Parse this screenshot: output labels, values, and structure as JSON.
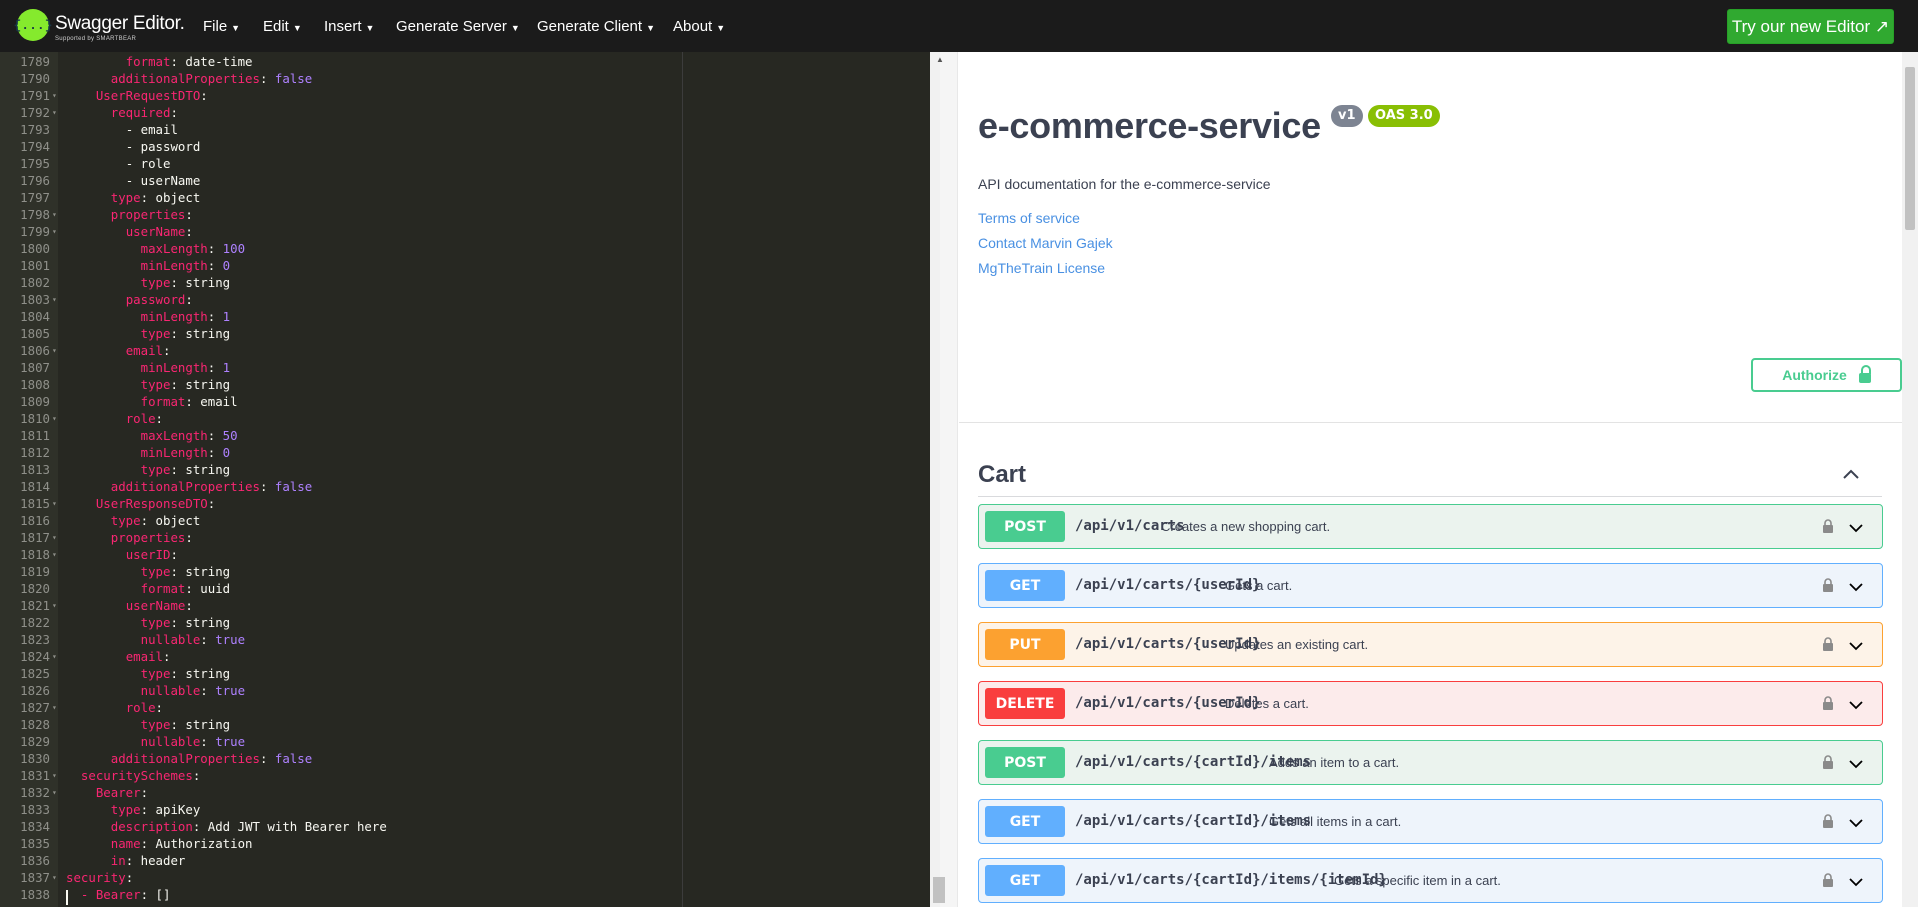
{
  "app": {
    "logo_glyph": "{...}",
    "name": "Swagger Editor.",
    "tagline": "Supported by SMARTBEAR",
    "menu": [
      "File",
      "Edit",
      "Insert",
      "Generate Server",
      "Generate Client",
      "About"
    ],
    "try_button": "Try our new Editor ↗"
  },
  "editor": {
    "lines": [
      {
        "num": "1789",
        "fold": "",
        "indent": "        ",
        "key": "format",
        "value": "date-time",
        "vtype": "v"
      },
      {
        "num": "1790",
        "fold": "",
        "indent": "      ",
        "key": "additionalProperties",
        "value": "false",
        "vtype": "b"
      },
      {
        "num": "1791",
        "fold": "▾",
        "indent": "    ",
        "key": "UserRequestDTO",
        "value": "",
        "vtype": "v"
      },
      {
        "num": "1792",
        "fold": "▾",
        "indent": "      ",
        "key": "required",
        "value": "",
        "vtype": "v"
      },
      {
        "num": "1793",
        "fold": "",
        "indent": "        ",
        "key": "",
        "value": "- email",
        "vtype": "v"
      },
      {
        "num": "1794",
        "fold": "",
        "indent": "        ",
        "key": "",
        "value": "- password",
        "vtype": "v"
      },
      {
        "num": "1795",
        "fold": "",
        "indent": "        ",
        "key": "",
        "value": "- role",
        "vtype": "v"
      },
      {
        "num": "1796",
        "fold": "",
        "indent": "        ",
        "key": "",
        "value": "- userName",
        "vtype": "v"
      },
      {
        "num": "1797",
        "fold": "",
        "indent": "      ",
        "key": "type",
        "value": "object",
        "vtype": "v"
      },
      {
        "num": "1798",
        "fold": "▾",
        "indent": "      ",
        "key": "properties",
        "value": "",
        "vtype": "v"
      },
      {
        "num": "1799",
        "fold": "▾",
        "indent": "        ",
        "key": "userName",
        "value": "",
        "vtype": "v"
      },
      {
        "num": "1800",
        "fold": "",
        "indent": "          ",
        "key": "maxLength",
        "value": "100",
        "vtype": "n"
      },
      {
        "num": "1801",
        "fold": "",
        "indent": "          ",
        "key": "minLength",
        "value": "0",
        "vtype": "n"
      },
      {
        "num": "1802",
        "fold": "",
        "indent": "          ",
        "key": "type",
        "value": "string",
        "vtype": "v"
      },
      {
        "num": "1803",
        "fold": "▾",
        "indent": "        ",
        "key": "password",
        "value": "",
        "vtype": "v"
      },
      {
        "num": "1804",
        "fold": "",
        "indent": "          ",
        "key": "minLength",
        "value": "1",
        "vtype": "n"
      },
      {
        "num": "1805",
        "fold": "",
        "indent": "          ",
        "key": "type",
        "value": "string",
        "vtype": "v"
      },
      {
        "num": "1806",
        "fold": "▾",
        "indent": "        ",
        "key": "email",
        "value": "",
        "vtype": "v"
      },
      {
        "num": "1807",
        "fold": "",
        "indent": "          ",
        "key": "minLength",
        "value": "1",
        "vtype": "n"
      },
      {
        "num": "1808",
        "fold": "",
        "indent": "          ",
        "key": "type",
        "value": "string",
        "vtype": "v"
      },
      {
        "num": "1809",
        "fold": "",
        "indent": "          ",
        "key": "format",
        "value": "email",
        "vtype": "v"
      },
      {
        "num": "1810",
        "fold": "▾",
        "indent": "        ",
        "key": "role",
        "value": "",
        "vtype": "v"
      },
      {
        "num": "1811",
        "fold": "",
        "indent": "          ",
        "key": "maxLength",
        "value": "50",
        "vtype": "n"
      },
      {
        "num": "1812",
        "fold": "",
        "indent": "          ",
        "key": "minLength",
        "value": "0",
        "vtype": "n"
      },
      {
        "num": "1813",
        "fold": "",
        "indent": "          ",
        "key": "type",
        "value": "string",
        "vtype": "v"
      },
      {
        "num": "1814",
        "fold": "",
        "indent": "      ",
        "key": "additionalProperties",
        "value": "false",
        "vtype": "b"
      },
      {
        "num": "1815",
        "fold": "▾",
        "indent": "    ",
        "key": "UserResponseDTO",
        "value": "",
        "vtype": "v"
      },
      {
        "num": "1816",
        "fold": "",
        "indent": "      ",
        "key": "type",
        "value": "object",
        "vtype": "v"
      },
      {
        "num": "1817",
        "fold": "▾",
        "indent": "      ",
        "key": "properties",
        "value": "",
        "vtype": "v"
      },
      {
        "num": "1818",
        "fold": "▾",
        "indent": "        ",
        "key": "userID",
        "value": "",
        "vtype": "v"
      },
      {
        "num": "1819",
        "fold": "",
        "indent": "          ",
        "key": "type",
        "value": "string",
        "vtype": "v"
      },
      {
        "num": "1820",
        "fold": "",
        "indent": "          ",
        "key": "format",
        "value": "uuid",
        "vtype": "v"
      },
      {
        "num": "1821",
        "fold": "▾",
        "indent": "        ",
        "key": "userName",
        "value": "",
        "vtype": "v"
      },
      {
        "num": "1822",
        "fold": "",
        "indent": "          ",
        "key": "type",
        "value": "string",
        "vtype": "v"
      },
      {
        "num": "1823",
        "fold": "",
        "indent": "          ",
        "key": "nullable",
        "value": "true",
        "vtype": "b"
      },
      {
        "num": "1824",
        "fold": "▾",
        "indent": "        ",
        "key": "email",
        "value": "",
        "vtype": "v"
      },
      {
        "num": "1825",
        "fold": "",
        "indent": "          ",
        "key": "type",
        "value": "string",
        "vtype": "v"
      },
      {
        "num": "1826",
        "fold": "",
        "indent": "          ",
        "key": "nullable",
        "value": "true",
        "vtype": "b"
      },
      {
        "num": "1827",
        "fold": "▾",
        "indent": "        ",
        "key": "role",
        "value": "",
        "vtype": "v"
      },
      {
        "num": "1828",
        "fold": "",
        "indent": "          ",
        "key": "type",
        "value": "string",
        "vtype": "v"
      },
      {
        "num": "1829",
        "fold": "",
        "indent": "          ",
        "key": "nullable",
        "value": "true",
        "vtype": "b"
      },
      {
        "num": "1830",
        "fold": "",
        "indent": "      ",
        "key": "additionalProperties",
        "value": "false",
        "vtype": "b"
      },
      {
        "num": "1831",
        "fold": "▾",
        "indent": "  ",
        "key": "securitySchemes",
        "value": "",
        "vtype": "v"
      },
      {
        "num": "1832",
        "fold": "▾",
        "indent": "    ",
        "key": "Bearer",
        "value": "",
        "vtype": "v"
      },
      {
        "num": "1833",
        "fold": "",
        "indent": "      ",
        "key": "type",
        "value": "apiKey",
        "vtype": "v"
      },
      {
        "num": "1834",
        "fold": "",
        "indent": "      ",
        "key": "description",
        "value": "Add JWT with Bearer here",
        "vtype": "v"
      },
      {
        "num": "1835",
        "fold": "",
        "indent": "      ",
        "key": "name",
        "value": "Authorization",
        "vtype": "v"
      },
      {
        "num": "1836",
        "fold": "",
        "indent": "      ",
        "key": "in",
        "value": "header",
        "vtype": "v"
      },
      {
        "num": "1837",
        "fold": "▾",
        "indent": "",
        "key": "security",
        "value": "",
        "vtype": "v"
      },
      {
        "num": "1838",
        "fold": "",
        "indent": "  ",
        "key": "- Bearer",
        "value": "[]",
        "vtype": "v"
      }
    ]
  },
  "info": {
    "title": "e-commerce-service",
    "version": "v1",
    "oas": "OAS 3.0",
    "description": "API documentation for the e-commerce-service",
    "links": [
      "Terms of service",
      "Contact Marvin Gajek",
      "MgTheTrain License"
    ],
    "authorize_label": "Authorize"
  },
  "tag": {
    "name": "Cart"
  },
  "operations": [
    {
      "method": "POST",
      "cls": "post",
      "path": "/api/v1/carts",
      "summary": "Creates a new shopping cart."
    },
    {
      "method": "GET",
      "cls": "get",
      "path": "/api/v1/carts/{userId}",
      "summary": "Gets a cart."
    },
    {
      "method": "PUT",
      "cls": "put",
      "path": "/api/v1/carts/{userId}",
      "summary": "Updates an existing cart."
    },
    {
      "method": "DELETE",
      "cls": "delete",
      "path": "/api/v1/carts/{userId}",
      "summary": "Deletes a cart."
    },
    {
      "method": "POST",
      "cls": "post",
      "path": "/api/v1/carts/{cartId}/items",
      "summary": "Adds an item to a cart."
    },
    {
      "method": "GET",
      "cls": "get",
      "path": "/api/v1/carts/{cartId}/items",
      "summary": "Gets all items in a cart."
    },
    {
      "method": "GET",
      "cls": "get",
      "path": "/api/v1/carts/{cartId}/items/{itemId}",
      "summary": "Gets a specific item in a cart."
    }
  ],
  "colors": {
    "post": "#49cc90",
    "get": "#61affe",
    "put": "#fca130",
    "delete": "#f93e3e",
    "topbar": "#1b1b1b",
    "try_button": "#30a930",
    "editor_bg": "#272822"
  },
  "icons": [
    "swagger-logo-icon",
    "caret-down-icon",
    "lock-icon",
    "chevron-down-icon",
    "chevron-up-icon",
    "external-link-icon"
  ]
}
